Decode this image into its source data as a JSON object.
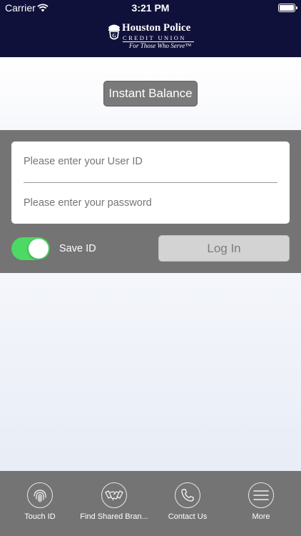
{
  "status_bar": {
    "carrier": "Carrier",
    "time": "3:21 PM"
  },
  "header": {
    "brand_name": "Houston Police",
    "brand_sub": "CREDIT UNION",
    "tagline": "For Those Who Serve™"
  },
  "instant_balance": {
    "label": "Instant Balance"
  },
  "login": {
    "userid_placeholder": "Please enter your User ID",
    "userid_value": "",
    "password_placeholder": "Please enter your password",
    "password_value": "",
    "save_id_label": "Save ID",
    "save_id_on": true,
    "login_label": "Log In"
  },
  "tabs": [
    {
      "label": "Touch ID",
      "icon": "fingerprint-icon"
    },
    {
      "label": "Find Shared Bran...",
      "icon": "handshake-icon"
    },
    {
      "label": "Contact Us",
      "icon": "phone-icon"
    },
    {
      "label": "More",
      "icon": "menu-icon"
    }
  ],
  "colors": {
    "header_bg": "#10113a",
    "panel_bg": "#747474",
    "toggle_on": "#4cd964",
    "button_gray": "#7a7a7a"
  }
}
